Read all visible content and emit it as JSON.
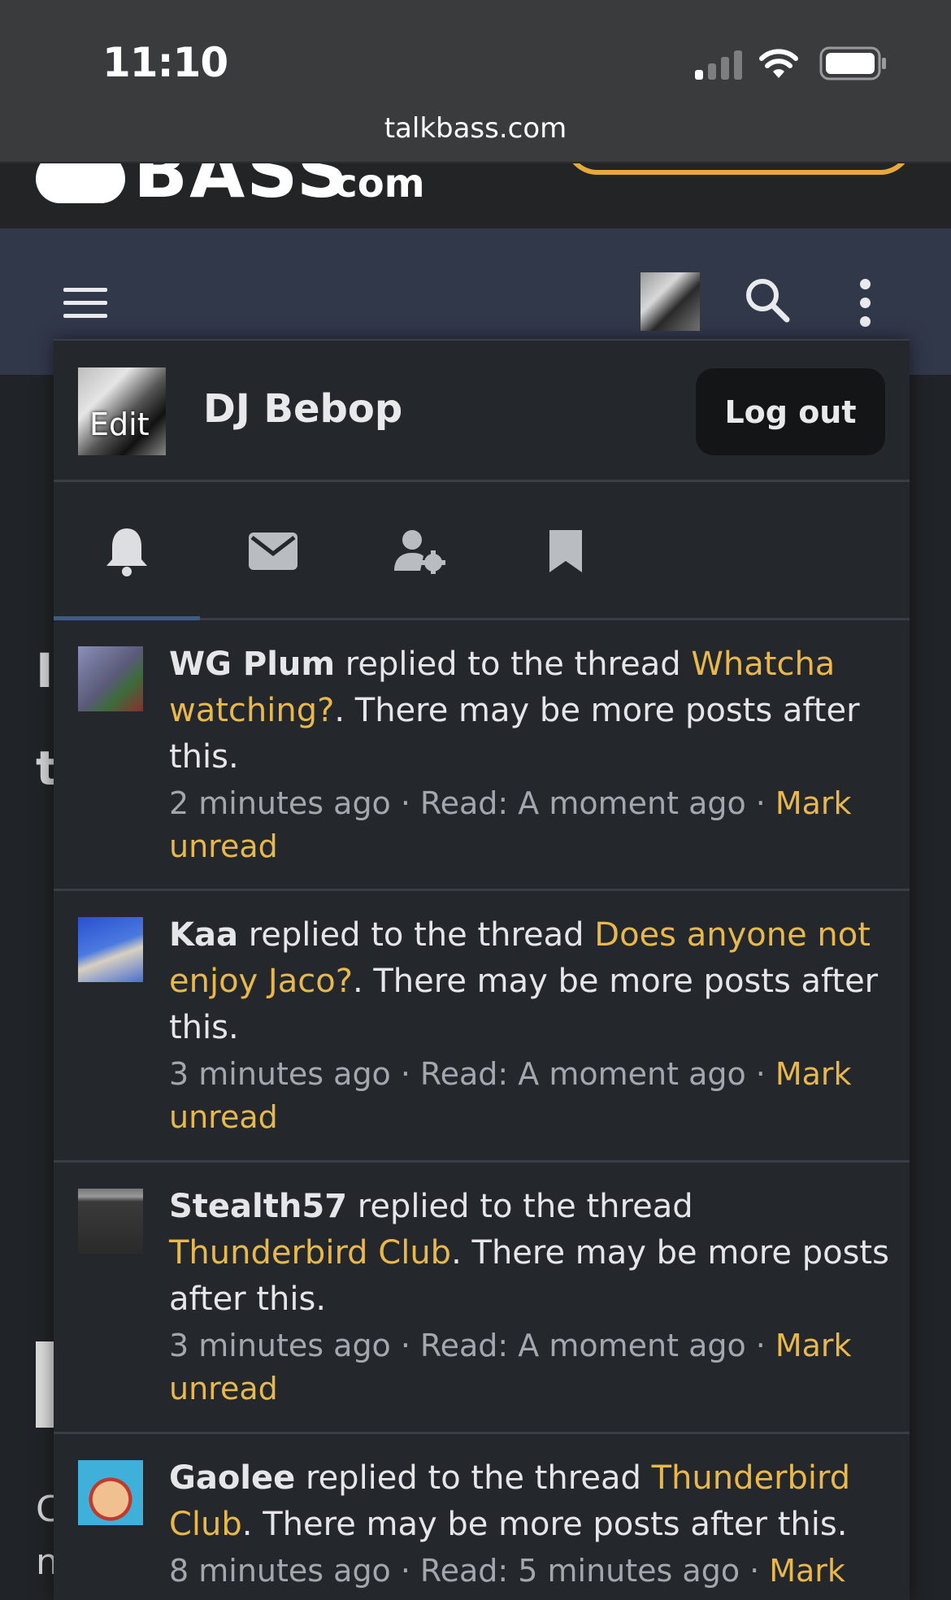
{
  "status_bar": {
    "time": "11:10",
    "url": "talkbass.com"
  },
  "site": {
    "logo_text": "BASS",
    "logo_suffix": ".com"
  },
  "menu": {
    "username": "DJ Bebop",
    "avatar_edit_label": "Edit",
    "logout_label": "Log out",
    "tabs": [
      {
        "icon": "bell-icon",
        "label": "Alerts"
      },
      {
        "icon": "envelope-icon",
        "label": "Conversations"
      },
      {
        "icon": "account-settings-icon",
        "label": "Account"
      },
      {
        "icon": "bookmark-icon",
        "label": "Bookmarks"
      }
    ]
  },
  "notifications": [
    {
      "user": "WG Plum",
      "action": "replied to the thread",
      "thread": "Whatcha watching?",
      "tail": ". There may be more posts after this.",
      "time": "2 minutes ago",
      "read": "Read: A moment ago",
      "mark": "Mark unread",
      "avatar_color": "#6b6f8a"
    },
    {
      "user": "Kaa",
      "action": "replied to the thread",
      "thread": "Does anyone not enjoy Jaco?",
      "tail": ". There may be more posts after this.",
      "time": "3 minutes ago",
      "read": "Read: A moment ago",
      "mark": "Mark unread",
      "avatar_color": "#3f6bd1"
    },
    {
      "user": "Stealth57",
      "action": "replied to the thread",
      "thread": "Thunderbird Club",
      "tail": ". There may be more posts after this.",
      "time": "3 minutes ago",
      "read": "Read: A moment ago",
      "mark": "Mark unread",
      "avatar_color": "#4a4a4a"
    },
    {
      "user": "Gaolee",
      "action": "replied to the thread",
      "thread": "Thunderbird Club",
      "tail": ". There may be more posts after this.",
      "time": "8 minutes ago",
      "read": "Read: 5 minutes ago",
      "mark": "Mark",
      "avatar_color": "#3fb0d9"
    }
  ],
  "background_page": {
    "letters": [
      "I",
      "t",
      "C",
      "n"
    ]
  },
  "colors": {
    "link": "#e8b84b",
    "menu_bg": "#24272b",
    "navbar_bg": "#31384a",
    "tab_active": "#3d5c86"
  }
}
